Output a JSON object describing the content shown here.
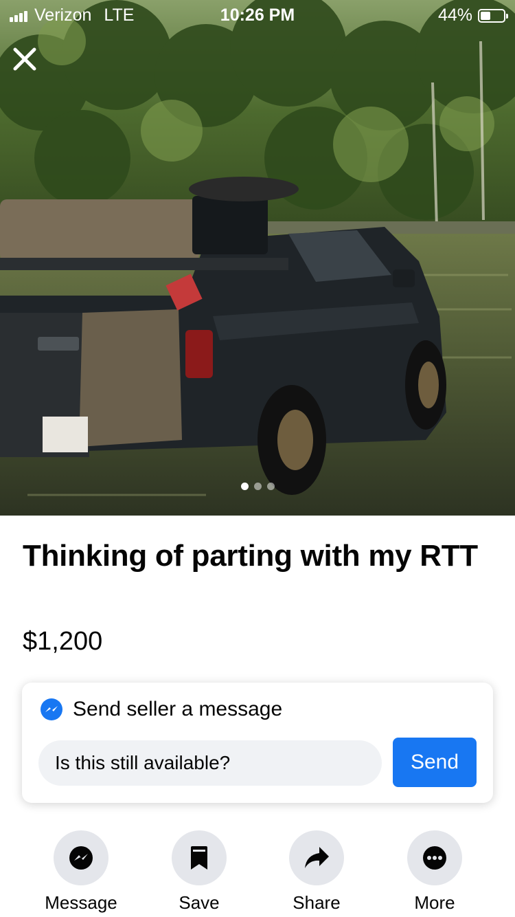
{
  "status_bar": {
    "carrier": "Verizon",
    "network": "LTE",
    "time": "10:26 PM",
    "battery_percent": "44%",
    "battery_level": 0.44
  },
  "photo": {
    "pager": {
      "count": 3,
      "active": 0
    }
  },
  "listing": {
    "title": "Thinking of parting with my RTT",
    "price": "$1,200"
  },
  "message_card": {
    "heading": "Send seller a message",
    "input_value": "Is this still available?",
    "send_label": "Send"
  },
  "actions": [
    {
      "label": "Message",
      "icon": "messenger-icon"
    },
    {
      "label": "Save",
      "icon": "bookmark-icon"
    },
    {
      "label": "Share",
      "icon": "share-arrow-icon"
    },
    {
      "label": "More",
      "icon": "more-dots-icon"
    }
  ],
  "colors": {
    "accent": "#1877f2",
    "button_bg": "#e4e6eb",
    "input_bg": "#f0f2f5"
  }
}
